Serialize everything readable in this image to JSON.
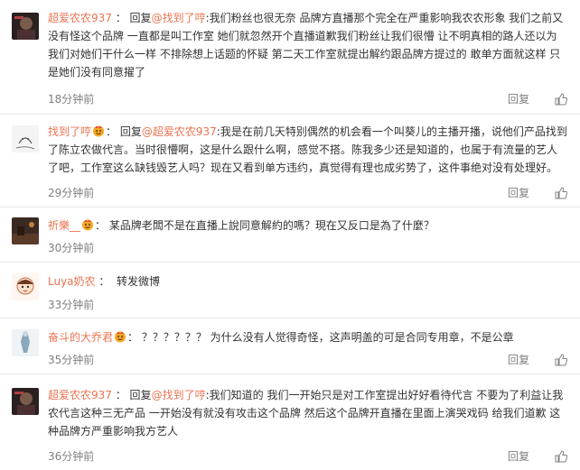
{
  "reply_prefix": "回复",
  "colon": ":",
  "reply_label": "回复",
  "colors": {
    "username": "#eb7350",
    "text": "#333333",
    "meta": "#808080",
    "divider": "#e8e8e8"
  },
  "comments": [
    {
      "user": "超爱农农937",
      "badge": false,
      "mention": "@找到了哼",
      "text": "我们粉丝也很无奈 品牌方直播那个完全在严重影响我农农形象 我们之前又没有怪这个品牌 一直都是叫工作室 她们就忽然开个直播道歉我们粉丝让我们很懵 让不明真相的路人还以为我们对她们干什么一样 不排除想上话题的怀疑 第二天工作室就提出解约跟品牌方提过的 敢单方面就这样 只是她们没有同意擢了",
      "time": "18分钟前",
      "avatar": "dark-portrait"
    },
    {
      "user": "找到了哼",
      "badge": true,
      "mention": "@超爱农农937",
      "text": "我是在前几天特别偶然的机会看一个叫葵儿的主播开播，说他们产品找到了陈立农做代言。当时很懵啊，这是什么跟什么啊，感觉不搭。陈我多少还是知道的，也属于有流量的艺人了吧，工作室这么缺钱毁艺人吗？现在又看到单方违约，真觉得有理也成劣势了，这件事绝对没有处理好。",
      "time": "29分钟前",
      "avatar": "sketch-face"
    },
    {
      "user": "祈樂__",
      "badge": true,
      "mention": "",
      "text": "某品牌老闆不是在直播上說同意解約的嗎？現在又反口是為了什麼？",
      "time": "30分钟前",
      "avatar": "dark-scene"
    },
    {
      "user": "Luya奶农",
      "badge": false,
      "mention": "",
      "text": "转发微博",
      "time": "33分钟前",
      "avatar": "cartoon-face"
    },
    {
      "user": "奋斗的大乔君",
      "badge": true,
      "mention": "",
      "text": "？？？？？？ 为什么没有人觉得奇怪，这声明盖的可是合同专用章，不是公章",
      "time": "35分钟前",
      "avatar": "figure"
    },
    {
      "user": "超爱农农937",
      "badge": false,
      "mention": "@找到了哼",
      "text": "我们知道的 我们一开始只是对工作室提出好好看待代言 不要为了利益让我农代言这种三无产品 一开始没有就没有攻击这个品牌 然后这个品牌开直播在里面上演哭戏码 给我们道歉 这种品牌方严重影响我方艺人",
      "time": "36分钟前",
      "avatar": "dark-portrait"
    }
  ]
}
